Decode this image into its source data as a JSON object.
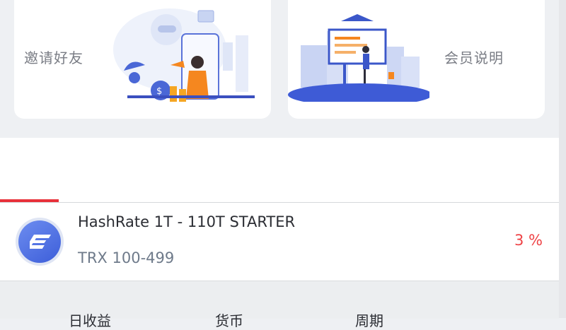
{
  "cards": {
    "invite_label": "邀请好友",
    "member_label": "会员说明"
  },
  "product": {
    "title": "HashRate 1T - 110T STARTER",
    "range": "TRX 100-499",
    "rate": "3 %",
    "logo_icon": "e-coin-logo-icon"
  },
  "detail": {
    "labels": [
      "日收益",
      "货币",
      "周期"
    ]
  },
  "colors": {
    "accent_red": "#e8313a",
    "rate_red": "#ee4346",
    "illustration_blue": "#4a67d6",
    "illustration_orange": "#f5871f"
  }
}
